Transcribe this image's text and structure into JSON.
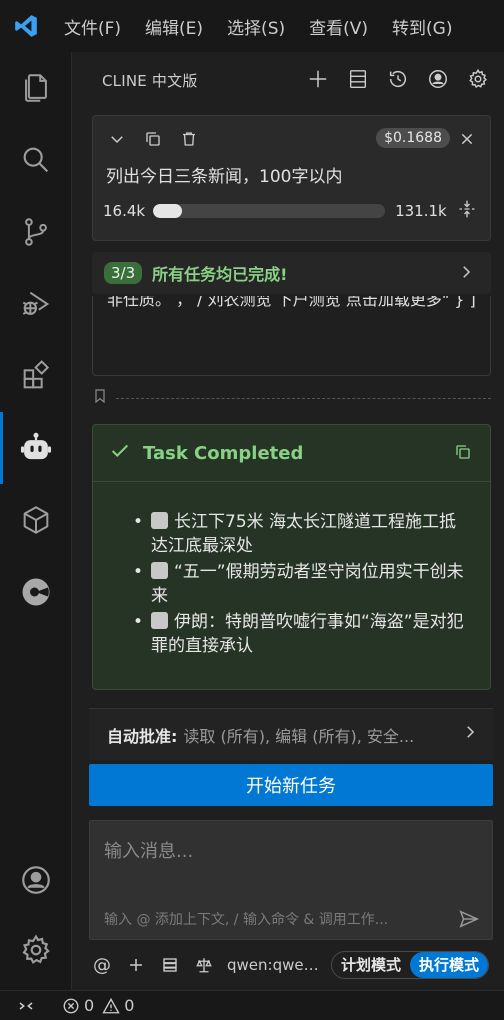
{
  "menu": {
    "items": [
      {
        "label": "文件(F)"
      },
      {
        "label": "编辑(E)"
      },
      {
        "label": "选择(S)"
      },
      {
        "label": "查看(V)"
      },
      {
        "label": "转到(G)"
      }
    ]
  },
  "activity": {
    "icons": [
      "explorer-icon",
      "search-icon",
      "source-control-icon",
      "run-debug-icon",
      "extensions-icon",
      "cline-icon",
      "box-icon",
      "circle-icon",
      "account-icon",
      "settings-icon"
    ],
    "active": "cline-icon"
  },
  "panel": {
    "title": "CLINE 中文版",
    "header_icons": [
      "plus-icon",
      "history-list-icon",
      "history-icon",
      "account-icon",
      "gear-icon"
    ]
  },
  "task": {
    "cost": "$0.1688",
    "text": "列出今日三条新闻，100字以内",
    "tokens_in": "16.4k",
    "tokens_max": "131.1k",
    "context_progress": 0.125
  },
  "progress": {
    "count": "3/3",
    "text": "所有任务均已完成!"
  },
  "prev_message": {
    "text": "非任质。  ， / 刘农测览 下户测览 点击加载更多\" } ]"
  },
  "completed": {
    "title": "Task Completed",
    "items": [
      "长江下75米 海太长江隧道工程施工抵达江底最深处",
      "“五一”假期劳动者坚守岗位用实干创未来",
      "伊朗：特朗普吹嘘行事如“海盗”是对犯罪的直接承认"
    ]
  },
  "auto_approve": {
    "label": "自动批准:",
    "value": "读取 (所有), 编辑 (所有), 安全..."
  },
  "new_task": {
    "label": "开始新任务"
  },
  "input": {
    "placeholder": "输入消息...",
    "hint": "输入 @ 添加上下文, / 输入命令 & 调用工作..."
  },
  "bottom": {
    "model": "qwen:qwen...",
    "plan_mode": "计划模式",
    "act_mode": "执行模式"
  },
  "status": {
    "errors": "0",
    "warnings": "0"
  },
  "colors": {
    "accent": "#0078d4",
    "success": "#89d185"
  }
}
